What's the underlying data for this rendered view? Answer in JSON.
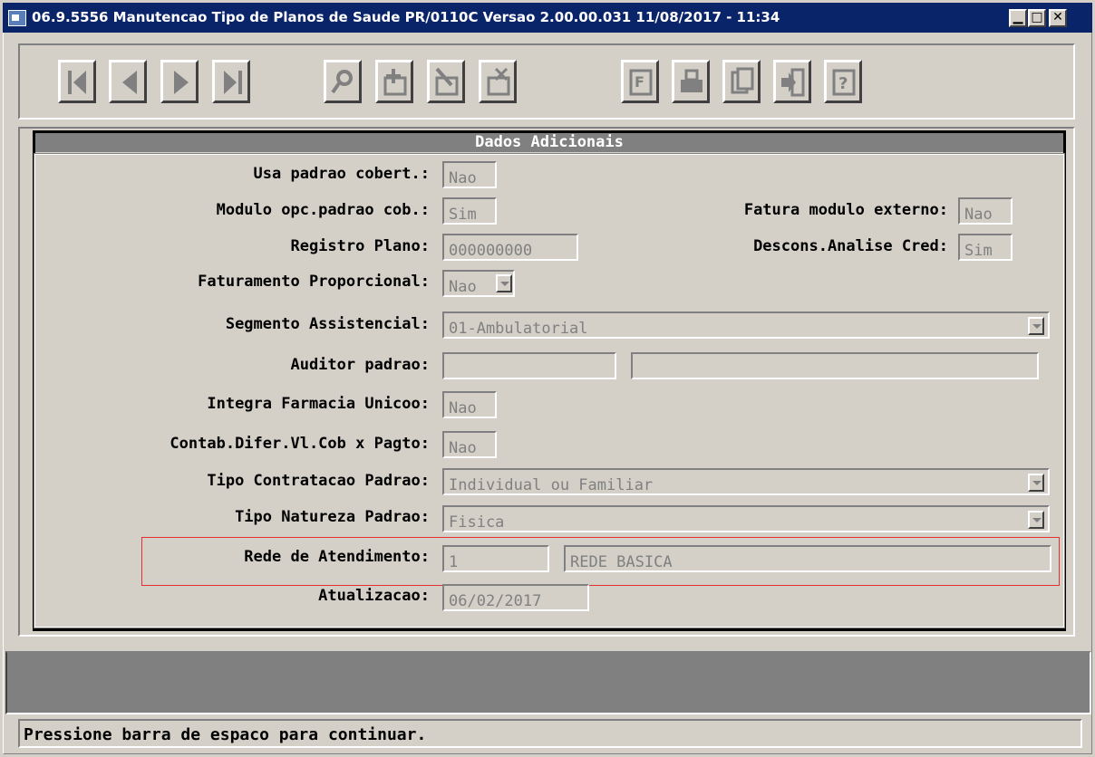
{
  "window": {
    "title": "06.9.5556 Manutencao  Tipo de Planos de Saude PR/0110C Versao 2.00.00.031 11/08/2017 - 11:34",
    "controls": [
      "minimize",
      "maximize",
      "close"
    ]
  },
  "toolbar": {
    "buttons": [
      {
        "name": "first-record",
        "icon": "first-icon"
      },
      {
        "name": "previous-record",
        "icon": "previous-icon"
      },
      {
        "name": "next-record",
        "icon": "next-icon"
      },
      {
        "name": "last-record",
        "icon": "last-icon"
      },
      {
        "name": "search",
        "icon": "search-icon"
      },
      {
        "name": "add",
        "icon": "add-icon"
      },
      {
        "name": "edit",
        "icon": "edit-icon"
      },
      {
        "name": "delete",
        "icon": "delete-icon"
      },
      {
        "name": "report",
        "icon": "report-icon",
        "letter": "F"
      },
      {
        "name": "print",
        "icon": "print-icon"
      },
      {
        "name": "copy",
        "icon": "copy-icon"
      },
      {
        "name": "exit",
        "icon": "exit-icon"
      },
      {
        "name": "help",
        "icon": "help-icon",
        "letter": "?"
      }
    ]
  },
  "section": {
    "title": "Dados Adicionais",
    "fields": {
      "usa_padrao_cobert": {
        "label": "Usa padrao cobert.:",
        "value": "Nao"
      },
      "modulo_opc": {
        "label": "Modulo opc.padrao cob.:",
        "value": "Sim"
      },
      "fatura_modulo_externo": {
        "label": "Fatura modulo externo:",
        "value": "Nao"
      },
      "registro_plano": {
        "label": "Registro Plano:",
        "value": "000000000"
      },
      "descons_analise": {
        "label": "Descons.Analise Cred:",
        "value": "Sim"
      },
      "faturamento_proporcional": {
        "label": "Faturamento Proporcional:",
        "value": "Nao"
      },
      "segmento_assistencial": {
        "label": "Segmento Assistencial:",
        "value": "01-Ambulatorial"
      },
      "auditor_padrao": {
        "label": "Auditor padrao:",
        "code": "",
        "name": ""
      },
      "integra_farmacia": {
        "label": "Integra Farmacia Unicoo:",
        "value": "Nao"
      },
      "contab_difer": {
        "label": "Contab.Difer.Vl.Cob x Pagto:",
        "value": "Nao"
      },
      "tipo_contratacao": {
        "label": "Tipo Contratacao Padrao:",
        "value": "Individual ou Familiar"
      },
      "tipo_natureza": {
        "label": "Tipo Natureza Padrao:",
        "value": "Fisica"
      },
      "rede_atendimento": {
        "label": "Rede de Atendimento:",
        "code": "1",
        "name": "REDE BASICA"
      },
      "atualizacao": {
        "label": "Atualizacao:",
        "value": "06/02/2017"
      }
    }
  },
  "status": {
    "text": "Pressione barra de espaco para continuar."
  },
  "colors": {
    "title_bar": "#0a246a",
    "highlight": "#e03030",
    "window_bg": "#d4d0c8"
  }
}
